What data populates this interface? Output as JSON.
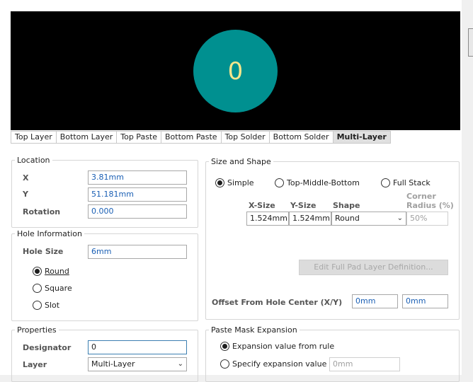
{
  "preview": {
    "pad_label": "0",
    "pad_color": "#009090",
    "label_color": "#f5e68c"
  },
  "tabs": [
    {
      "label": "Top Layer",
      "active": false
    },
    {
      "label": "Bottom Layer",
      "active": false
    },
    {
      "label": "Top Paste",
      "active": false
    },
    {
      "label": "Bottom Paste",
      "active": false
    },
    {
      "label": "Top Solder",
      "active": false
    },
    {
      "label": "Bottom Solder",
      "active": false
    },
    {
      "label": "Multi-Layer",
      "active": true
    }
  ],
  "location": {
    "title": "Location",
    "x_label": "X",
    "x_value": "3.81mm",
    "y_label": "Y",
    "y_value": "51.181mm",
    "rotation_label": "Rotation",
    "rotation_value": "0.000"
  },
  "hole": {
    "title": "Hole Information",
    "size_label": "Hole Size",
    "size_value": "6mm",
    "round": "Round",
    "square": "Square",
    "slot": "Slot",
    "selected": "Round"
  },
  "properties": {
    "title": "Properties",
    "designator_label": "Designator",
    "designator_value": "0",
    "layer_label": "Layer",
    "layer_value": "Multi-Layer"
  },
  "size_shape": {
    "title": "Size and Shape",
    "simple": "Simple",
    "tmb": "Top-Middle-Bottom",
    "full_stack": "Full Stack",
    "selected": "Simple",
    "col_xsize": "X-Size",
    "col_ysize": "Y-Size",
    "col_shape": "Shape",
    "col_corner_1": "Corner",
    "col_corner_2": "Radius (%)",
    "xsize_value": "1.524mm",
    "ysize_value": "1.524mm",
    "shape_value": "Round",
    "corner_value": "50%",
    "edit_button": "Edit Full Pad Layer Definition...",
    "offset_label": "Offset From Hole Center (X/Y)",
    "offset_x": "0mm",
    "offset_y": "0mm"
  },
  "paste": {
    "title": "Paste Mask Expansion",
    "from_rule": "Expansion value from rule",
    "specify": "Specify expansion value",
    "specify_value": "0mm",
    "selected": "rule"
  }
}
